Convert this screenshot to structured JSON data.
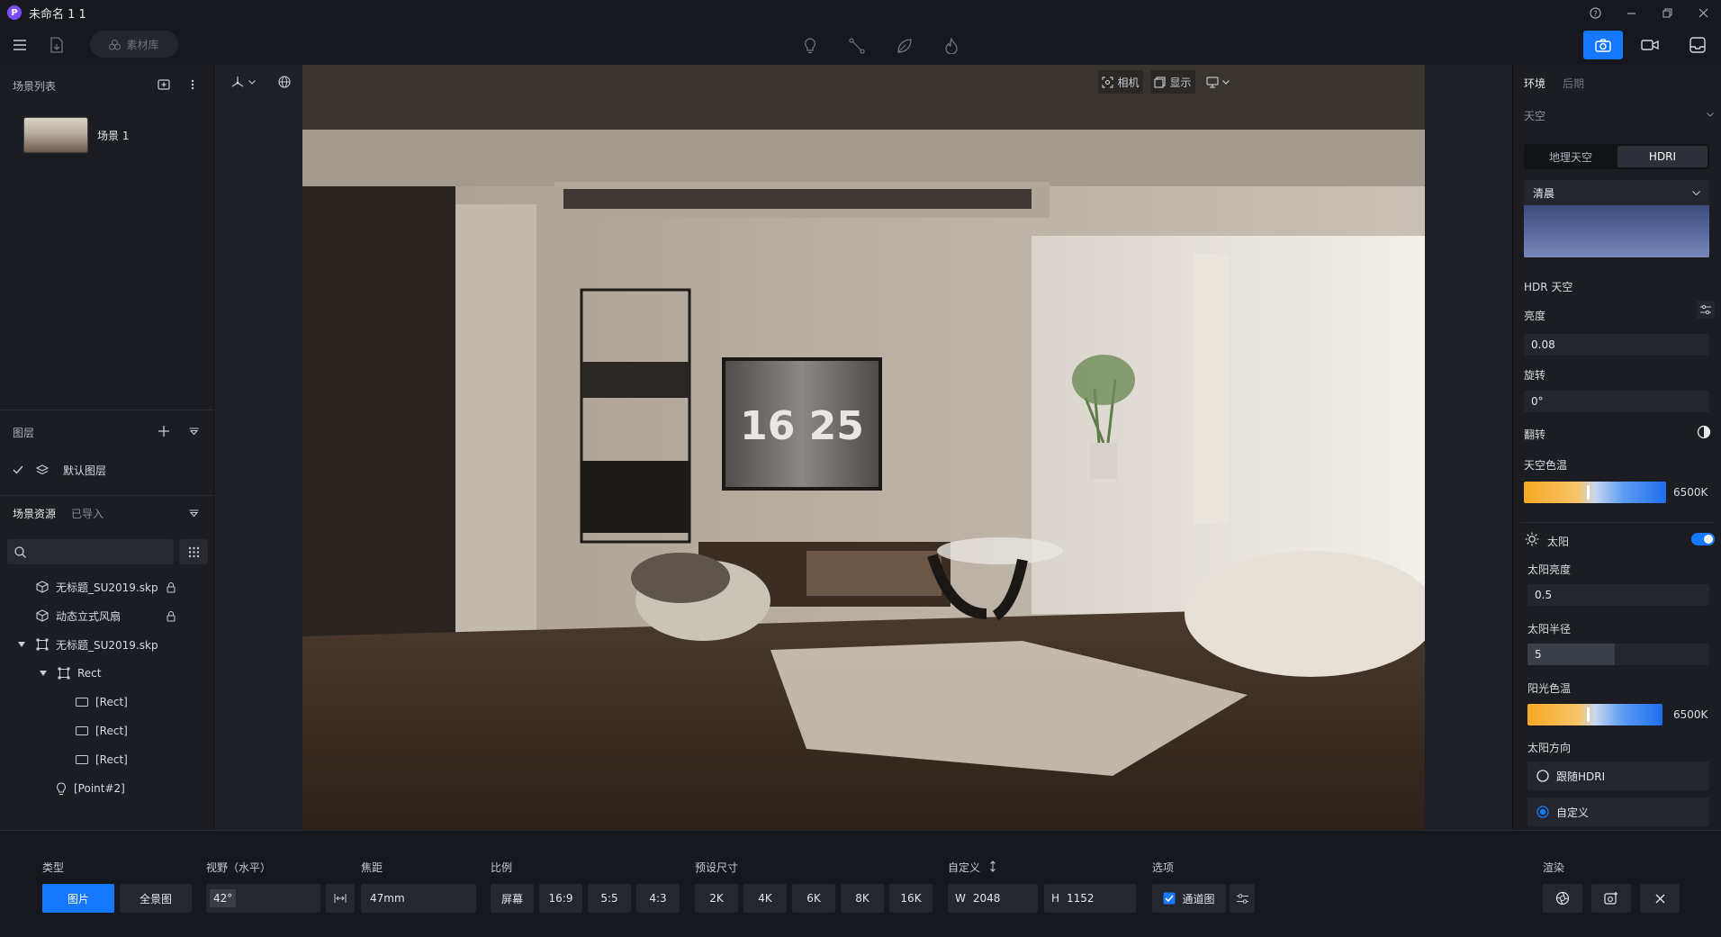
{
  "app": {
    "logo_letter": "P",
    "title": "未命名 1 1"
  },
  "toolbar": {
    "material_label": "素材库"
  },
  "left_panel": {
    "scene_list_title": "场景列表",
    "scenes": [
      {
        "label": "场景 1"
      }
    ],
    "layers_title": "图层",
    "default_layer": "默认图层",
    "assets_tab_active": "场景资源",
    "assets_tab_imported": "已导入",
    "tree": [
      {
        "label": "无标题_SU2019.skp"
      },
      {
        "label": "动态立式风扇"
      },
      {
        "label": "无标题_SU2019.skp"
      },
      {
        "label": "Rect"
      },
      {
        "label": "[Rect]"
      },
      {
        "label": "[Rect]"
      },
      {
        "label": "[Rect]"
      },
      {
        "label": "[Point#2]"
      }
    ]
  },
  "viewport": {
    "camera_label": "相机",
    "display_label": "显示",
    "tv_clock": "16 25"
  },
  "right_panel": {
    "tab_environment": "环境",
    "tab_post": "后期",
    "sky_title": "天空",
    "sky_mode_geo": "地理天空",
    "sky_mode_hdri": "HDRI",
    "hdri_preset": "清晨",
    "hdr_sky_title": "HDR 天空",
    "brightness_label": "亮度",
    "brightness_value": "0.08",
    "rotation_label": "旋转",
    "rotation_value": "0°",
    "flip_label": "翻转",
    "sky_temp_label": "天空色温",
    "sky_temp_value": "6500K",
    "sky_temp_level": 0.44,
    "sun_title": "太阳",
    "sun_enabled": true,
    "sun_brightness_label": "太阳亮度",
    "sun_brightness_value": "0.5",
    "sun_radius_label": "太阳半径",
    "sun_radius_value": "5",
    "sun_temp_label": "阳光色温",
    "sun_temp_value": "6500K",
    "sun_temp_level": 0.44,
    "sun_dir_label": "太阳方向",
    "sun_dir_follow": "跟随HDRI",
    "sun_dir_custom": "自定义"
  },
  "bottom_bar": {
    "type_label": "类型",
    "type_image": "图片",
    "type_panorama": "全景图",
    "fov_label": "视野（水平）",
    "fov_value": "42°",
    "focal_label": "焦距",
    "focal_value": "47mm",
    "ratio_label": "比例",
    "ratios": [
      "屏幕",
      "16:9",
      "5:5",
      "4:3"
    ],
    "preset_label": "预设尺寸",
    "presets": [
      "2K",
      "4K",
      "6K",
      "8K",
      "16K"
    ],
    "custom_label": "自定义",
    "width_prefix": "W",
    "width_value": "2048",
    "height_prefix": "H",
    "height_value": "1152",
    "options_label": "选项",
    "channel_label": "通道图",
    "render_label": "渲染"
  },
  "colors": {
    "accent": "#1677ff",
    "panel": "#1b1d22",
    "titlebar": "#16181d"
  }
}
